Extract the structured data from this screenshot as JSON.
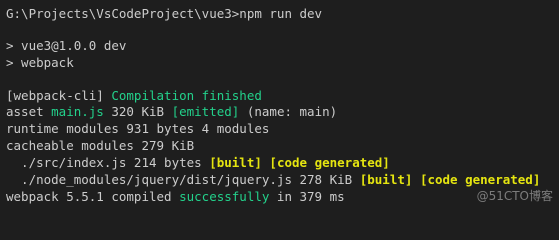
{
  "terminal": {
    "lines": [
      {
        "segments": [
          {
            "text": "G:\\Projects\\VsCodeProject\\vue3>npm run dev",
            "color": "default"
          }
        ]
      },
      {
        "segments": [
          {
            "text": "",
            "color": "default"
          }
        ]
      },
      {
        "segments": [
          {
            "text": "> vue3@1.0.0 dev",
            "color": "default"
          }
        ]
      },
      {
        "segments": [
          {
            "text": "> webpack",
            "color": "default"
          }
        ]
      },
      {
        "segments": [
          {
            "text": "",
            "color": "default"
          }
        ]
      },
      {
        "segments": [
          {
            "text": "[webpack-cli] ",
            "color": "default"
          },
          {
            "text": "Compilation finished",
            "color": "green"
          }
        ]
      },
      {
        "segments": [
          {
            "text": "asset ",
            "color": "default"
          },
          {
            "text": "main.js",
            "color": "green"
          },
          {
            "text": " 320 KiB ",
            "color": "default"
          },
          {
            "text": "[emitted]",
            "color": "green"
          },
          {
            "text": " (name: main)",
            "color": "default"
          }
        ]
      },
      {
        "segments": [
          {
            "text": "runtime modules 931 bytes 4 modules",
            "color": "default"
          }
        ]
      },
      {
        "segments": [
          {
            "text": "cacheable modules 279 KiB",
            "color": "default"
          }
        ]
      },
      {
        "segments": [
          {
            "text": "  ./src/index.js 214 bytes ",
            "color": "default"
          },
          {
            "text": "[built]",
            "color": "yellow"
          },
          {
            "text": " ",
            "color": "default"
          },
          {
            "text": "[code generated]",
            "color": "yellow"
          }
        ]
      },
      {
        "segments": [
          {
            "text": "  ./node_modules/jquery/dist/jquery.js 278 KiB ",
            "color": "default"
          },
          {
            "text": "[built]",
            "color": "yellow"
          },
          {
            "text": " ",
            "color": "default"
          },
          {
            "text": "[code generated]",
            "color": "yellow"
          }
        ]
      },
      {
        "segments": [
          {
            "text": "webpack 5.5.1 compiled ",
            "color": "default"
          },
          {
            "text": "successfully",
            "color": "green"
          },
          {
            "text": " in 379 ms",
            "color": "default"
          }
        ]
      }
    ]
  },
  "watermark": {
    "text": "@51CTO博客"
  },
  "colors": {
    "background": "#1e1e1e",
    "default": "#cccccc",
    "green": "#23d18b",
    "yellow": "#e5e510"
  }
}
